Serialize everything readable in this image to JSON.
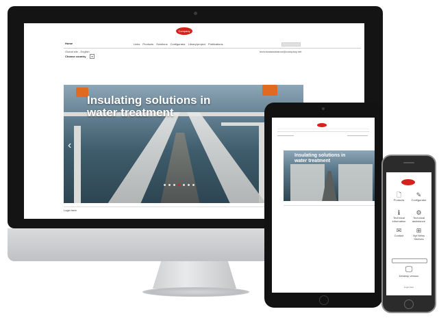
{
  "site": {
    "logo_text": "Company",
    "home_label": "Home",
    "nav": [
      "Links",
      "Products",
      "Solutions",
      "Configurator",
      "Library/project",
      "Publications"
    ],
    "locale": "Global site - English",
    "email": "technicalassistance@company.net",
    "choose_country": "Choose country",
    "dropdown_glyph": "▾",
    "hero_title_line1": "Insulating solutions in",
    "hero_title_line2": "water treatment",
    "hero_prev": "‹",
    "carousel": {
      "count": 7,
      "active": 3
    },
    "login": "Login here"
  },
  "tablet": {
    "hero_title_line1": "Insulating solutions in",
    "hero_title_line2": "water treatment"
  },
  "phone": {
    "tiles": [
      {
        "icon": "🗋",
        "label": "Products",
        "icon_name": "document-icon"
      },
      {
        "icon": "✎",
        "label": "Configurator",
        "icon_name": "edit-icon"
      },
      {
        "icon": "ℹ",
        "label": "Technical information",
        "icon_name": "info-icon"
      },
      {
        "icon": "⚙",
        "label": "Technical assistance",
        "icon_name": "gear-icon"
      },
      {
        "icon": "✉",
        "label": "Contact",
        "icon_name": "contact-icon"
      },
      {
        "icon": "⊞",
        "label": "Nyt News Shelves",
        "icon_name": "news-icon"
      }
    ],
    "desktop_icon": "🖵",
    "desktop_label": "Desktop version",
    "login": "Login here"
  },
  "colors": {
    "brand": "#d4221d",
    "accent": "#e06a1f"
  }
}
